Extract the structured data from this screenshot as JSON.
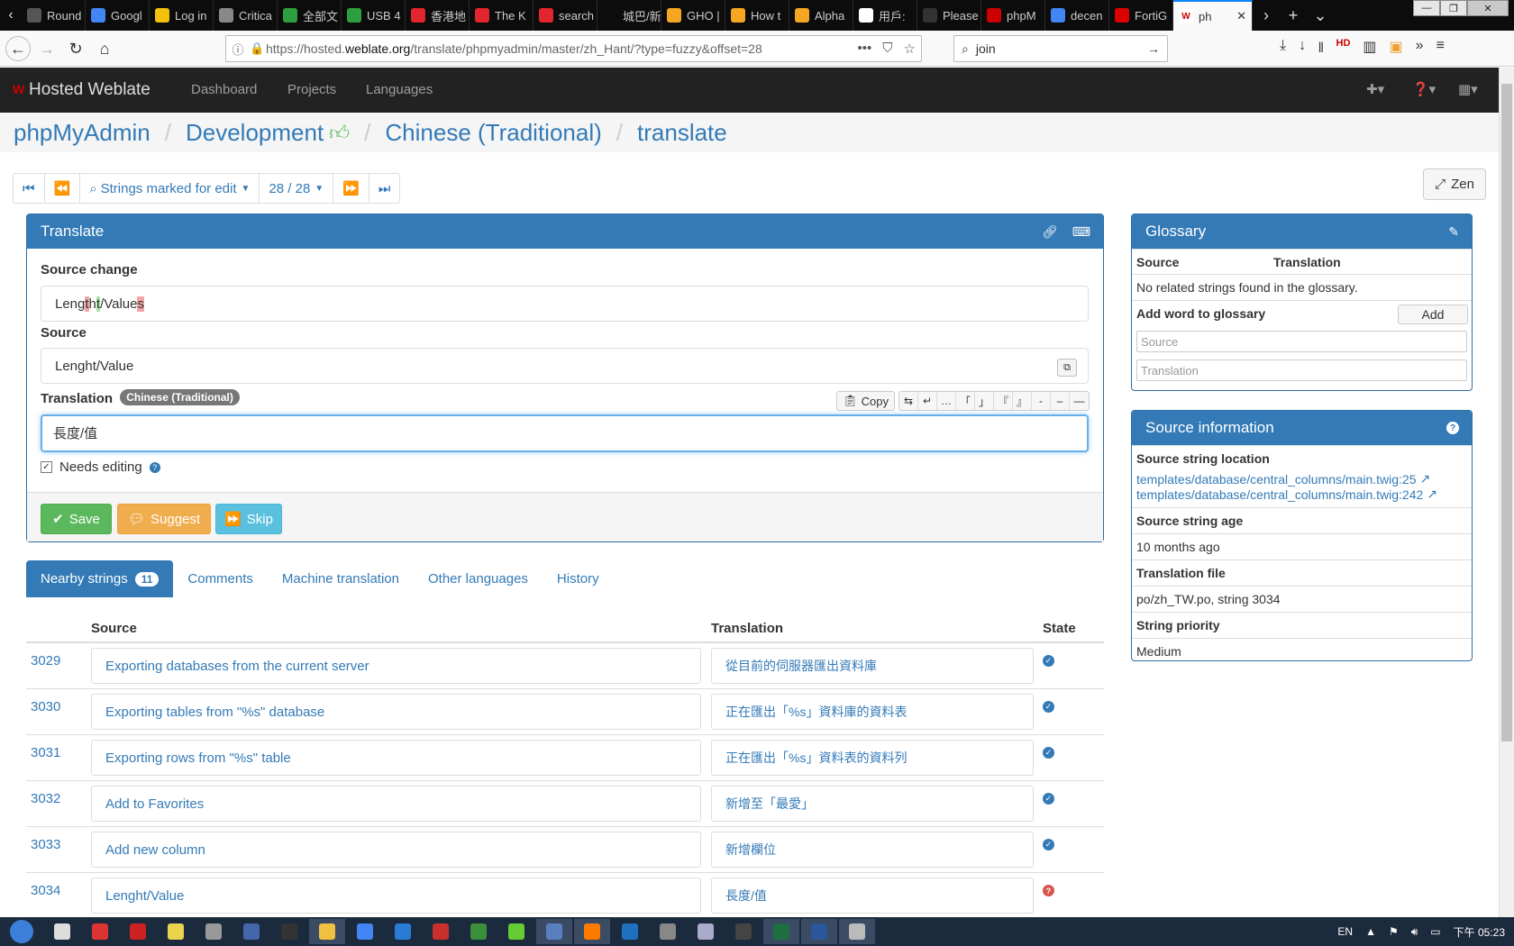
{
  "browser": {
    "tabs": [
      {
        "label": "Round",
        "color": "#555"
      },
      {
        "label": "Googl",
        "color": "#4285f4"
      },
      {
        "label": "Log in",
        "color": "#f4c20d"
      },
      {
        "label": "Critica",
        "color": "#888"
      },
      {
        "label": "全部文",
        "color": "#2e9f3e"
      },
      {
        "label": "USB 4",
        "color": "#2e9f3e"
      },
      {
        "label": "香港地",
        "color": "#e0262c"
      },
      {
        "label": "The K",
        "color": "#e0262c"
      },
      {
        "label": "search",
        "color": "#e0262c"
      },
      {
        "label": "城巴/新巴",
        "color": "#0c0c0c"
      },
      {
        "label": "GHO |",
        "color": "#f5a623"
      },
      {
        "label": "How t",
        "color": "#f5a623"
      },
      {
        "label": "Alpha",
        "color": "#f5a623"
      },
      {
        "label": "用戶:",
        "color": "#ffffff"
      },
      {
        "label": "Please",
        "color": "#333"
      },
      {
        "label": "phpM",
        "color": "#c00"
      },
      {
        "label": "decen",
        "color": "#4285f4"
      },
      {
        "label": "FortiG",
        "color": "#d00"
      }
    ],
    "active_tab": {
      "label": "ph"
    },
    "url_prefix": "https://hosted.",
    "url_domain": "weblate.org",
    "url_path": "/translate/phpmyadmin/master/zh_Hant/?type=fuzzy&offset=28",
    "search_value": "join"
  },
  "app": {
    "brand": "Hosted Weblate",
    "nav": {
      "dashboard": "Dashboard",
      "projects": "Projects",
      "languages": "Languages"
    },
    "breadcrumb": {
      "project": "phpMyAdmin",
      "component": "Development",
      "language": "Chinese (Traditional)",
      "action": "translate"
    }
  },
  "pager": {
    "filter_label": "Strings marked for edit",
    "position": "28 / 28"
  },
  "zen_label": "Zen",
  "translate": {
    "panel_title": "Translate",
    "source_change_label": "Source change",
    "source_change_parts": {
      "p1": "Leng",
      "del1": "t",
      "p2": "h",
      "ins1": "t",
      "p3": "/Value",
      "del2": "s"
    },
    "source_label": "Source",
    "source_text": "Lenght/Value",
    "translation_label": "Translation",
    "language_badge": "Chinese (Traditional)",
    "copy_label": "Copy",
    "special_chars": [
      "⇆",
      "↵",
      "…",
      "「",
      "」",
      "『",
      "』",
      "-",
      "–",
      "—"
    ],
    "translation_value": "長度/值",
    "needs_editing_label": "Needs editing",
    "save_label": "Save",
    "suggest_label": "Suggest",
    "skip_label": "Skip"
  },
  "tabs": {
    "nearby": "Nearby strings",
    "nearby_count": "11",
    "comments": "Comments",
    "machine": "Machine translation",
    "other": "Other languages",
    "history": "History"
  },
  "nearby": {
    "headers": {
      "source": "Source",
      "translation": "Translation",
      "state": "State"
    },
    "rows": [
      {
        "num": "3029",
        "source": "Exporting databases from the current server",
        "translation": "從目前的伺服器匯出資料庫",
        "state": "ok"
      },
      {
        "num": "3030",
        "source": "Exporting tables from \"%s\" database",
        "translation": "正在匯出「%s」資料庫的資料表",
        "state": "ok"
      },
      {
        "num": "3031",
        "source": "Exporting rows from \"%s\" table",
        "translation": "正在匯出「%s」資料表的資料列",
        "state": "ok"
      },
      {
        "num": "3032",
        "source": "Add to Favorites",
        "translation": "新增至「最愛」",
        "state": "ok"
      },
      {
        "num": "3033",
        "source": "Add new column",
        "translation": "新增欄位",
        "state": "ok"
      },
      {
        "num": "3034",
        "source": "Lenght/Value",
        "translation": "長度/值",
        "state": "fuzzy"
      }
    ]
  },
  "glossary": {
    "title": "Glossary",
    "col_source": "Source",
    "col_translation": "Translation",
    "empty": "No related strings found in the glossary.",
    "add_label": "Add word to glossary",
    "add_button": "Add",
    "source_placeholder": "Source",
    "translation_placeholder": "Translation"
  },
  "source_info": {
    "title": "Source information",
    "location_label": "Source string location",
    "locations": [
      "templates/database/central_columns/main.twig:25",
      "templates/database/central_columns/main.twig:242"
    ],
    "age_label": "Source string age",
    "age_value": "10 months ago",
    "file_label": "Translation file",
    "file_value": "po/zh_TW.po, string 3034",
    "priority_label": "String priority",
    "priority_value": "Medium"
  },
  "taskbar": {
    "apps": [
      {
        "color": "#ddd"
      },
      {
        "color": "#d33"
      },
      {
        "color": "#c22"
      },
      {
        "color": "#e8d44d"
      },
      {
        "color": "#999"
      },
      {
        "color": "#4466aa"
      },
      {
        "color": "#333"
      },
      {
        "color": "#f0c040",
        "open": true
      },
      {
        "color": "#4285f4"
      },
      {
        "color": "#2a7bd4"
      },
      {
        "color": "#c9302c"
      },
      {
        "color": "#3a8f3a"
      },
      {
        "color": "#6c3"
      },
      {
        "color": "#5a7fbf",
        "open": true
      },
      {
        "color": "#ff7b00",
        "open": true
      },
      {
        "color": "#1f70c1"
      },
      {
        "color": "#888"
      },
      {
        "color": "#aac"
      },
      {
        "color": "#444"
      },
      {
        "color": "#1d6f42",
        "open": true
      },
      {
        "color": "#2b579a",
        "open": true
      },
      {
        "color": "#bbb",
        "open": true
      }
    ],
    "lang": "EN",
    "clock": "下午 05:23"
  },
  "colors": {
    "primary": "#337ab7",
    "save": "#5cb85c",
    "suggest": "#f0ad4e",
    "skip": "#5bc0de",
    "ok_state": "#337ab7",
    "fuzzy_state": "#d9534f"
  }
}
